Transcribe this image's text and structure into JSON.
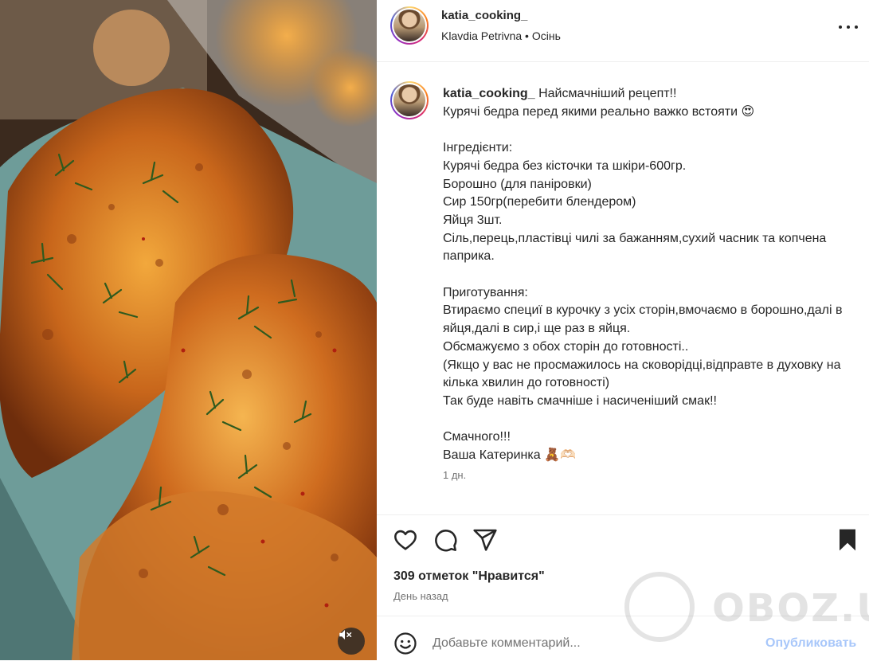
{
  "post": {
    "username": "katia_cooking_",
    "subtitle": "Klavdia Petrivna • Осінь",
    "caption_first_line": "Найсмачніший рецепт!!",
    "caption_body": "Курячі бедра перед якими реально важко встояти 😍\n\nІнгредієнти:\nКурячі бедра без кісточки та шкіри-600гр.\nБорошно (для паніровки)\nСир 150гр(перебити блендером)\nЯйця 3шт.\nСіль,перець,пластівці чилі за бажанням,сухий часник та копчена паприка.\n\nПриготування:\nВтираємо специї в курочку з усіх сторін,вмочаємо в борошно,далі в яйця,далі в сир,і ще раз в яйця.\nОбсмажуємо з обох сторін до готовності..\n(Якщо у вас не просмажилось на сковорідці,відправте в духовку на кілька хвилин до готовності)\nТак буде навіть смачніше і насиченіший смак!!\n\nСмачного!!!\nВаша Катеринка 🧸🫶🏻",
    "caption_time": "1 дн.",
    "likes_text": "309 отметок \"Нравится\"",
    "posted_ago": "День назад"
  },
  "comment": {
    "placeholder": "Добавьте комментарий...",
    "publish_label": "Опубликовать"
  },
  "watermark": {
    "text": "OBOZ.UA"
  },
  "icons": [
    "more-icon",
    "heart-icon",
    "comment-icon",
    "share-icon",
    "bookmark-icon",
    "emoji-icon",
    "mute-icon"
  ],
  "colors": {
    "text": "#262626",
    "secondary": "#737373",
    "publish_disabled": "#a8c7fa",
    "divider": "#efefef"
  }
}
